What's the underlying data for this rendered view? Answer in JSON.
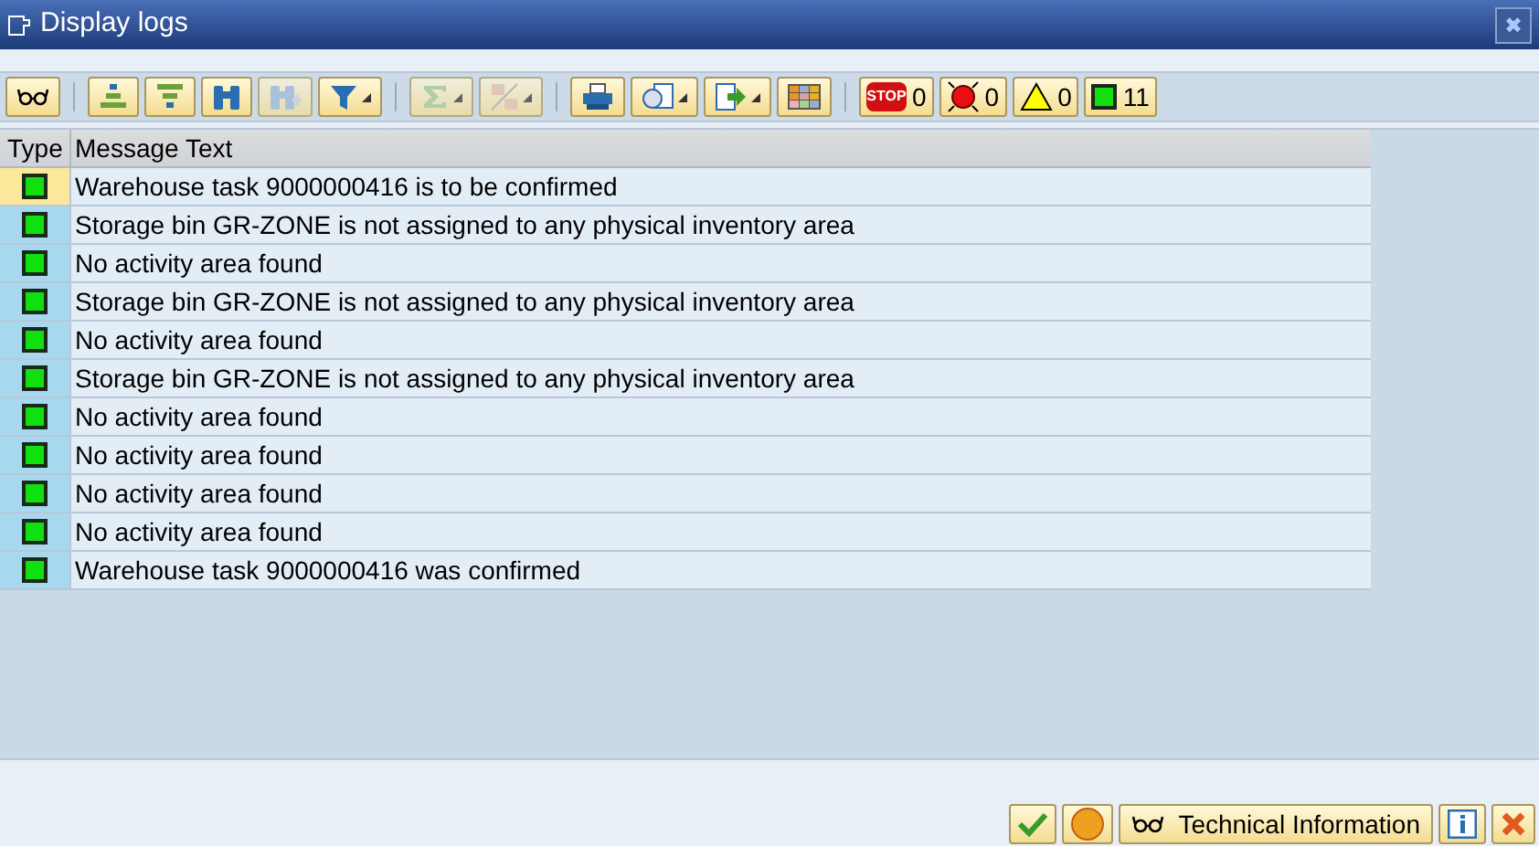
{
  "window": {
    "title": "Display logs",
    "close": "✖"
  },
  "toolbar_groups": [
    [
      {
        "disabled": false,
        "dropdown": false
      }
    ],
    [
      {
        "disabled": false,
        "dropdown": false
      },
      {
        "disabled": false,
        "dropdown": false
      },
      {
        "disabled": false,
        "dropdown": false
      },
      {
        "disabled": true,
        "dropdown": false
      },
      {
        "disabled": false,
        "dropdown": true
      }
    ],
    [
      {
        "disabled": true,
        "dropdown": true
      },
      {
        "disabled": true,
        "dropdown": true
      }
    ],
    [
      {
        "disabled": false,
        "dropdown": false
      },
      {
        "disabled": false,
        "dropdown": true
      },
      {
        "disabled": false,
        "dropdown": true
      },
      {
        "disabled": false,
        "dropdown": false
      }
    ]
  ],
  "counters": [
    {
      "kind": "stop",
      "icon_text": "STOP",
      "count": "0"
    },
    {
      "kind": "error",
      "count": "0"
    },
    {
      "kind": "warning",
      "count": "0"
    },
    {
      "kind": "success",
      "count": "11"
    }
  ],
  "table": {
    "columns": [
      "Type",
      "Message Text"
    ],
    "rows": [
      {
        "text": "Warehouse task 9000000416 is to be confirmed",
        "selected": true
      },
      {
        "text": "Storage bin GR-ZONE is not assigned to any physical inventory area",
        "selected": false
      },
      {
        "text": "No activity area found",
        "selected": false
      },
      {
        "text": "Storage bin GR-ZONE is not assigned to any physical inventory area",
        "selected": false
      },
      {
        "text": "No activity area found",
        "selected": false
      },
      {
        "text": "Storage bin GR-ZONE is not assigned to any physical inventory area",
        "selected": false
      },
      {
        "text": "No activity area found",
        "selected": false
      },
      {
        "text": "No activity area found",
        "selected": false
      },
      {
        "text": "No activity area found",
        "selected": false
      },
      {
        "text": "No activity area found",
        "selected": false
      },
      {
        "text": "Warehouse task 9000000416 was confirmed",
        "selected": false
      }
    ]
  },
  "footer_buttons": [
    {
      "kind": "ok"
    },
    {
      "kind": "help"
    },
    {
      "kind": "technical",
      "label": "Technical Information"
    },
    {
      "kind": "info"
    },
    {
      "kind": "cancel"
    }
  ]
}
